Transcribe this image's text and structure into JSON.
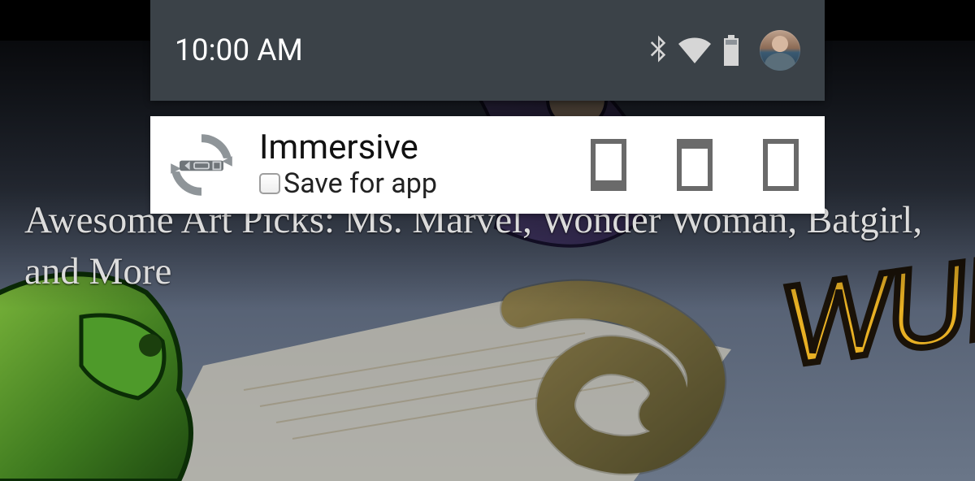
{
  "shade": {
    "time": "10:00 AM",
    "icons": {
      "bluetooth": "bluetooth",
      "wifi": "wifi",
      "battery": "battery"
    }
  },
  "notification": {
    "title": "Immersive",
    "save_label": "Save for app",
    "save_checked": false,
    "modes": {
      "navbar_only": "mode-navbar-only",
      "statusbar_only": "mode-statusbar-only",
      "full_immersive": "mode-full-immersive"
    }
  },
  "page": {
    "headline": "Awesome Art Picks: Ms. Marvel, Wonder Woman, Batgirl, and More"
  }
}
